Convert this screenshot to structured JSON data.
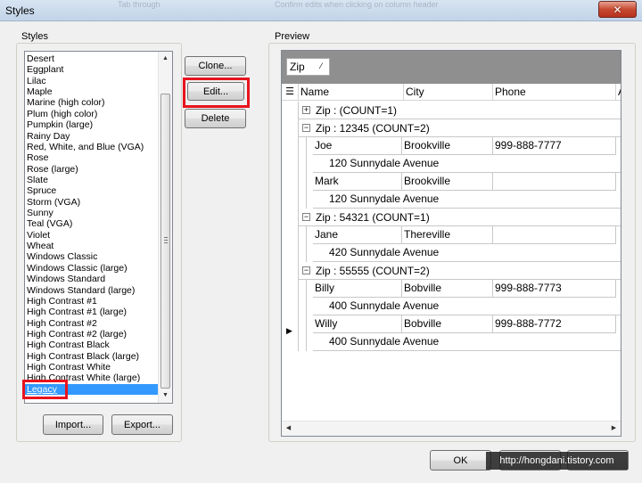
{
  "window": {
    "title": "Styles",
    "close_glyph": "✕"
  },
  "ghost_text": {
    "left": "Tab through",
    "right": "Confirm edits when clicking on column header"
  },
  "styles_group": {
    "label": "Styles"
  },
  "preview_group": {
    "label": "Preview"
  },
  "style_list": {
    "items": [
      "Desert",
      "Eggplant",
      "Lilac",
      "Maple",
      "Marine (high color)",
      "Plum (high color)",
      "Pumpkin (large)",
      "Rainy Day",
      "Red, White, and Blue (VGA)",
      "Rose",
      "Rose (large)",
      "Slate",
      "Spruce",
      "Storm (VGA)",
      "Sunny",
      "Teal (VGA)",
      "Violet",
      "Wheat",
      "Windows Classic",
      "Windows Classic (large)",
      "Windows Standard",
      "Windows Standard (large)",
      "High Contrast #1",
      "High Contrast #1 (large)",
      "High Contrast #2",
      "High Contrast #2 (large)",
      "High Contrast Black",
      "High Contrast Black (large)",
      "High Contrast White",
      "High Contrast White (large)",
      "Legacy"
    ],
    "selected": "Legacy"
  },
  "buttons": {
    "clone": "Clone...",
    "edit": "Edit...",
    "delete": "Delete",
    "import": "Import...",
    "export": "Export...",
    "ok": "OK"
  },
  "grid": {
    "groupby_chip": "Zip",
    "sort_glyph": "⁄",
    "headers": [
      "Name",
      "City",
      "Phone",
      "A"
    ],
    "groups": [
      {
        "toggle": "+",
        "label": "Zip :  (COUNT=1)",
        "records": []
      },
      {
        "toggle": "−",
        "label": "Zip : 12345 (COUNT=2)",
        "records": [
          {
            "name": "Joe",
            "city": "Brookville",
            "phone": "999-888-7777",
            "address": "120 Sunnydale Avenue"
          },
          {
            "name": "Mark",
            "city": "Brookville",
            "phone": "",
            "address": "120 Sunnydale Avenue"
          }
        ]
      },
      {
        "toggle": "−",
        "label": "Zip : 54321 (COUNT=1)",
        "records": [
          {
            "name": "Jane",
            "city": "Thereville",
            "phone": "",
            "address": "420 Sunnydale Avenue"
          }
        ]
      },
      {
        "toggle": "−",
        "label": "Zip : 55555 (COUNT=2)",
        "records": [
          {
            "name": "Billy",
            "city": "Bobville",
            "phone": "999-888-7773",
            "address": "400 Sunnydale Avenue"
          },
          {
            "name": "Willy",
            "city": "Bobville",
            "phone": "999-888-7772",
            "address": "400 Sunnydale Avenue"
          }
        ]
      }
    ],
    "current_row_glyph": "▶"
  },
  "watermark": "http://hongdani.tistory.com",
  "colors": {
    "selection": "#3399ff",
    "highlight": "#e8131e",
    "groupby_bar": "#8f8f8f"
  }
}
